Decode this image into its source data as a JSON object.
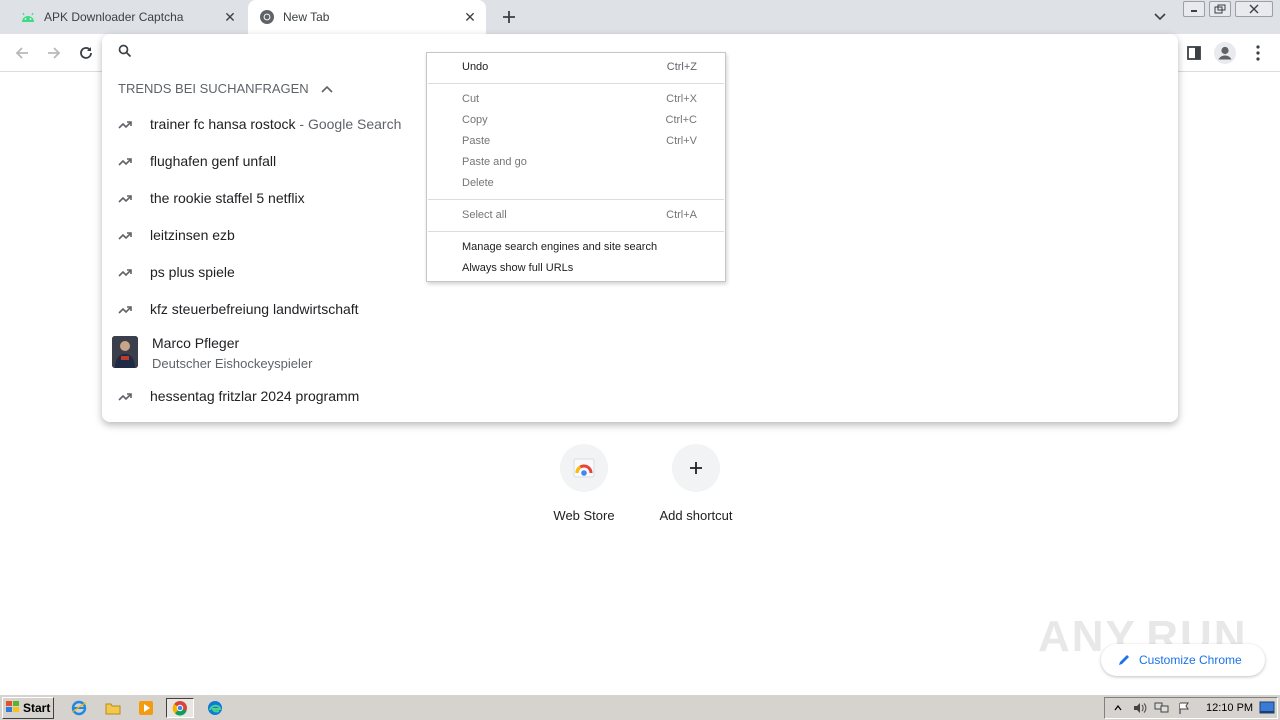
{
  "tabs": [
    {
      "title": "APK Downloader Captcha",
      "icon": "android-icon",
      "active": false
    },
    {
      "title": "New Tab",
      "icon": "chrome-icon",
      "active": true
    }
  ],
  "omnibox": {
    "input_value": "",
    "header": "TRENDS BEI SUCHANFRAGEN",
    "suggestions": [
      {
        "text": "trainer fc hansa rostock",
        "suffix": " - Google Search"
      },
      {
        "text": "flughafen genf unfall"
      },
      {
        "text": "the rookie staffel 5 netflix"
      },
      {
        "text": "leitzinsen ezb"
      },
      {
        "text": "ps plus spiele"
      },
      {
        "text": "kfz steuerbefreiung landwirtschaft"
      }
    ],
    "entity": {
      "name": "Marco Pfleger",
      "description": "Deutscher Eishockeyspieler"
    },
    "last_suggestion": {
      "text": "hessentag fritzlar 2024 programm"
    }
  },
  "context_menu": {
    "undo": {
      "label": "Undo",
      "shortcut": "Ctrl+Z",
      "enabled": true
    },
    "cut": {
      "label": "Cut",
      "shortcut": "Ctrl+X",
      "enabled": false
    },
    "copy": {
      "label": "Copy",
      "shortcut": "Ctrl+C",
      "enabled": false
    },
    "paste": {
      "label": "Paste",
      "shortcut": "Ctrl+V",
      "enabled": false
    },
    "paste_and_go": {
      "label": "Paste and go",
      "enabled": false
    },
    "delete": {
      "label": "Delete",
      "enabled": false
    },
    "select_all": {
      "label": "Select all",
      "shortcut": "Ctrl+A",
      "enabled": false
    },
    "manage_search": {
      "label": "Manage search engines and site search",
      "enabled": true
    },
    "full_urls": {
      "label": "Always show full URLs",
      "enabled": true
    }
  },
  "shortcuts": [
    {
      "label": "Web Store",
      "icon": "web-store-icon"
    },
    {
      "label": "Add shortcut",
      "icon": "plus-icon"
    }
  ],
  "customize": {
    "label": "Customize Chrome"
  },
  "watermark": "ANY.RUN",
  "taskbar": {
    "start_label": "Start",
    "clock": "12:10 PM"
  },
  "colors": {
    "tabstrip": "#dee1e6",
    "accent": "#1a73e8",
    "taskbar": "#d6d3ce"
  }
}
